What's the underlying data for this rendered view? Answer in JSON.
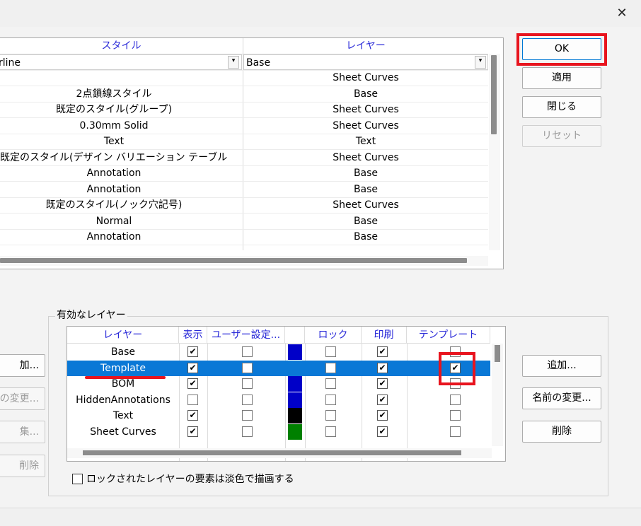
{
  "window": {
    "close_glyph": "✕"
  },
  "styles_grid": {
    "headers": {
      "style": "スタイル",
      "layer": "レイヤー"
    },
    "edit_row": {
      "style": "rline",
      "layer": "Base",
      "dropdown_glyph": "▾"
    },
    "rows": [
      {
        "style": "",
        "layer": "Sheet Curves"
      },
      {
        "style": "2点鎖線スタイル",
        "layer": "Base"
      },
      {
        "style": "既定のスタイル(グループ)",
        "layer": "Sheet Curves"
      },
      {
        "style": "0.30mm Solid",
        "layer": "Sheet Curves"
      },
      {
        "style": "Text",
        "layer": "Text"
      },
      {
        "style": "既定のスタイル(デザイン バリエーション テーブル)",
        "layer": "Sheet Curves"
      },
      {
        "style": "Annotation",
        "layer": "Base"
      },
      {
        "style": "Annotation",
        "layer": "Base"
      },
      {
        "style": "既定のスタイル(ノック穴記号)",
        "layer": "Sheet Curves"
      },
      {
        "style": "Normal",
        "layer": "Base"
      },
      {
        "style": "Annotation",
        "layer": "Base"
      }
    ]
  },
  "buttons": {
    "ok": "OK",
    "apply": "適用",
    "close": "閉じる",
    "reset": "リセット"
  },
  "layers_group": {
    "title": "有効なレイヤー",
    "headers": {
      "layer": "レイヤー",
      "show": "表示",
      "user": "ユーザー設定...",
      "color": "",
      "lock": "ロック",
      "print": "印刷",
      "template": "テンプレート"
    },
    "rows": [
      {
        "name": "Base",
        "show": true,
        "user": false,
        "color": "#0000c8",
        "lock": false,
        "print": true,
        "template": false
      },
      {
        "name": "Template",
        "show": true,
        "user": false,
        "color": "#0a78d6",
        "lock": false,
        "print": true,
        "template": true,
        "selected": true
      },
      {
        "name": "BOM",
        "show": true,
        "user": false,
        "color": "#0000c8",
        "lock": false,
        "print": true,
        "template": false
      },
      {
        "name": "HiddenAnnotations",
        "show": false,
        "user": false,
        "color": "#0000c8",
        "lock": false,
        "print": true,
        "template": false
      },
      {
        "name": "Text",
        "show": true,
        "user": false,
        "color": "#000000",
        "lock": false,
        "print": true,
        "template": false
      },
      {
        "name": "Sheet Curves",
        "show": true,
        "user": false,
        "color": "#008000",
        "lock": false,
        "print": true,
        "template": false
      }
    ],
    "check_glyph": "✔",
    "buttons": {
      "add": "追加...",
      "rename": "名前の変更...",
      "delete": "削除"
    },
    "left_buttons": {
      "add": "加...",
      "rename": "の変更...",
      "edit": "集...",
      "delete": "削除"
    },
    "lock_dim_label": "ロックされたレイヤーの要素は淡色で描画する"
  },
  "colors": {
    "selection": "#0a78d6",
    "highlight": "#e8141e",
    "header_text": "#2a2ad8"
  }
}
